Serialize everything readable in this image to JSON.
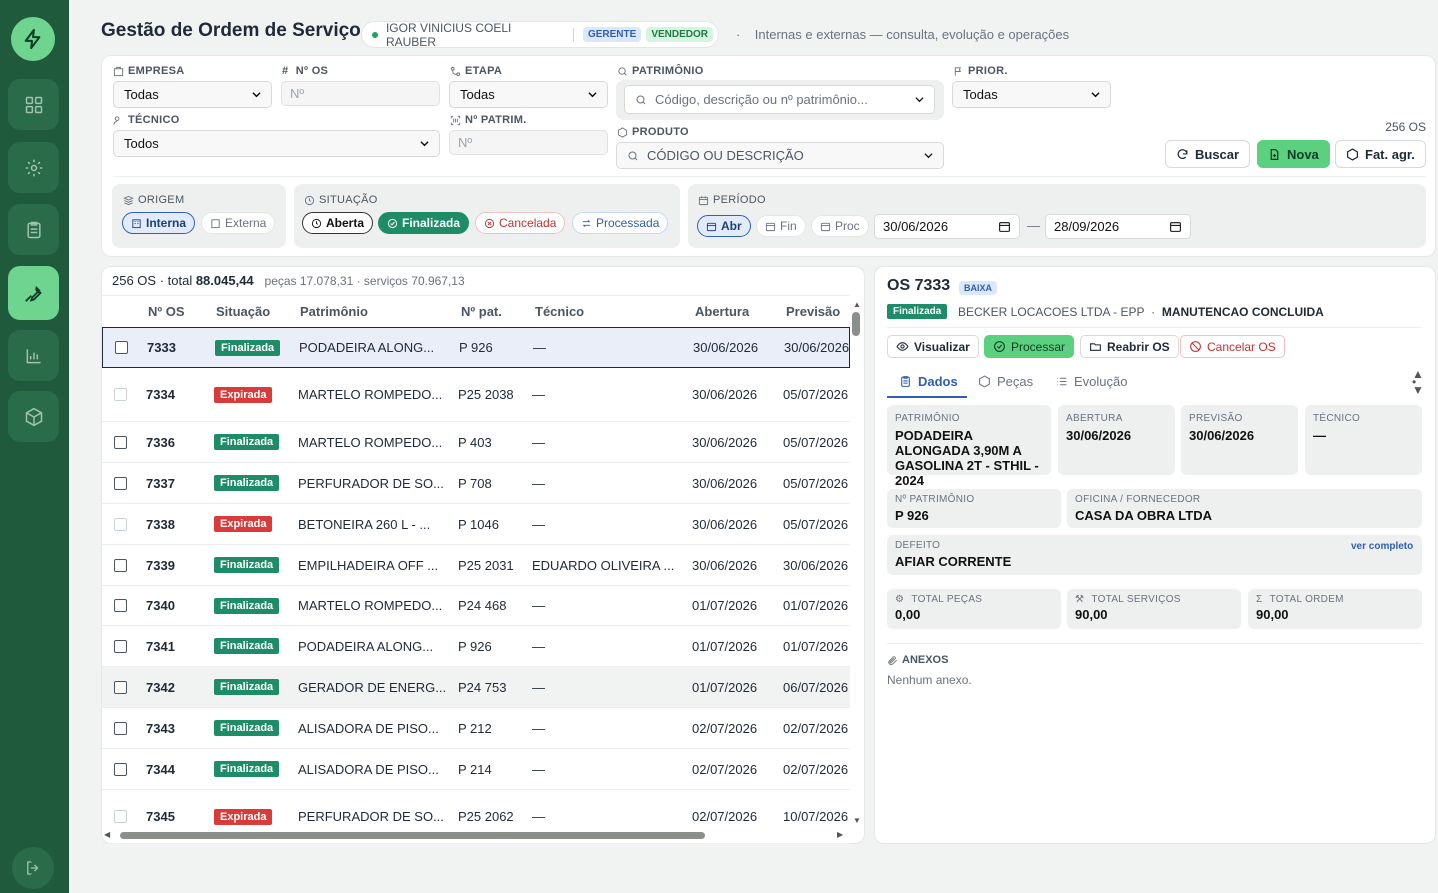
{
  "page": {
    "title": "Gestão de Ordem de Serviço",
    "user": "IGOR VINICIUS COELI RAUBER",
    "role1": "GERENTE",
    "role2": "VENDEDOR",
    "subtitle": "Internas e externas — consulta, evolução e operações"
  },
  "filters": {
    "empresa_label": "EMPRESA",
    "empresa_value": "Todas",
    "nos_label": "Nº OS",
    "nos_placeholder": "Nº",
    "etapa_label": "ETAPA",
    "etapa_value": "Todas",
    "patrimonio_label": "PATRIMÔNIO",
    "patrimonio_placeholder": "Código, descrição ou nº patrimônio...",
    "prior_label": "PRIOR.",
    "prior_value": "Todas",
    "tecnico_label": "TÉCNICO",
    "tecnico_value": "Todos",
    "npatrim_label": "Nº PATRIM.",
    "npatrim_placeholder": "Nº",
    "produto_label": "PRODUTO",
    "produto_placeholder": "CÓDIGO OU DESCRIÇÃO",
    "count": "256 OS",
    "buscar": "Buscar",
    "nova": "Nova",
    "fatagr": "Fat. agr."
  },
  "origem": {
    "label": "ORIGEM",
    "interna": "Interna",
    "externa": "Externa"
  },
  "situacao": {
    "label": "SITUAÇÃO",
    "aberta": "Aberta",
    "finalizada": "Finalizada",
    "cancelada": "Cancelada",
    "processada": "Processada"
  },
  "periodo": {
    "label": "PERÍODO",
    "abr": "Abr",
    "fin": "Fin",
    "proc": "Proc",
    "from": "30/06/2026",
    "to": "28/09/2026",
    "dash": "—"
  },
  "summary": {
    "count": "256 OS · total ",
    "total": "88.045,44",
    "extra": "peças 17.078,31 · serviços 70.967,13"
  },
  "columns": [
    "Nº OS",
    "Situação",
    "Patrimônio",
    "Nº pat.",
    "Técnico",
    "Abertura",
    "Previsão"
  ],
  "rows": [
    {
      "os": "7333",
      "st": "Finalizada",
      "pat": "PODADEIRA ALONG...",
      "np": "P 926",
      "tec": "—",
      "ab": "30/06/2026",
      "pv": "30/06/2026"
    },
    {
      "os": "7334",
      "st": "Expirada",
      "pat": "MARTELO ROMPEDO...",
      "np": "P25 2038",
      "tec": "—",
      "ab": "30/06/2026",
      "pv": "05/07/2026"
    },
    {
      "os": "7336",
      "st": "Finalizada",
      "pat": "MARTELO ROMPEDO...",
      "np": "P 403",
      "tec": "—",
      "ab": "30/06/2026",
      "pv": "05/07/2026"
    },
    {
      "os": "7337",
      "st": "Finalizada",
      "pat": "PERFURADOR DE SO...",
      "np": "P 708",
      "tec": "—",
      "ab": "30/06/2026",
      "pv": "05/07/2026"
    },
    {
      "os": "7338",
      "st": "Expirada",
      "pat": "BETONEIRA 260 L - ...",
      "np": "P 1046",
      "tec": "—",
      "ab": "30/06/2026",
      "pv": "05/07/2026"
    },
    {
      "os": "7339",
      "st": "Finalizada",
      "pat": "EMPILHADEIRA OFF ...",
      "np": "P25 2031",
      "tec": "EDUARDO OLIVEIRA ...",
      "ab": "30/06/2026",
      "pv": "30/06/2026"
    },
    {
      "os": "7340",
      "st": "Finalizada",
      "pat": "MARTELO ROMPEDO...",
      "np": "P24 468",
      "tec": "—",
      "ab": "01/07/2026",
      "pv": "01/07/2026"
    },
    {
      "os": "7341",
      "st": "Finalizada",
      "pat": "PODADEIRA ALONG...",
      "np": "P 926",
      "tec": "—",
      "ab": "01/07/2026",
      "pv": "01/07/2026"
    },
    {
      "os": "7342",
      "st": "Finalizada",
      "pat": "GERADOR DE ENERG...",
      "np": "P24 753",
      "tec": "—",
      "ab": "01/07/2026",
      "pv": "06/07/2026"
    },
    {
      "os": "7343",
      "st": "Finalizada",
      "pat": "ALISADORA DE PISO...",
      "np": "P 212",
      "tec": "—",
      "ab": "02/07/2026",
      "pv": "02/07/2026"
    },
    {
      "os": "7344",
      "st": "Finalizada",
      "pat": "ALISADORA DE PISO...",
      "np": "P 214",
      "tec": "—",
      "ab": "02/07/2026",
      "pv": "02/07/2026"
    },
    {
      "os": "7345",
      "st": "Expirada",
      "pat": "PERFURADOR DE SO...",
      "np": "P25 2062",
      "tec": "—",
      "ab": "02/07/2026",
      "pv": "10/07/2026"
    }
  ],
  "detail": {
    "os": "OS 7333",
    "tag": "BAIXA",
    "status": "Finalizada",
    "cliente": "BECKER LOCACOES LTDA - EPP",
    "dot": "·",
    "etapa": "MANUTENCAO CONCLUIDA",
    "visualizar": "Visualizar",
    "processar": "Processar",
    "reabrir": "Reabrir OS",
    "cancelar": "Cancelar OS",
    "tab_dados": "Dados",
    "tab_pecas": "Peças",
    "tab_evolucao": "Evolução",
    "patrimonio_l": "PATRIMÔNIO",
    "patrimonio_v": "PODADEIRA ALONGADA 3,90M A GASOLINA 2T - STHIL - 2024",
    "abertura_l": "ABERTURA",
    "abertura_v": "30/06/2026",
    "previsao_l": "PREVISÃO",
    "previsao_v": "30/06/2026",
    "tecnico_l": "TÉCNICO",
    "tecnico_v": "—",
    "npat_l": "Nº PATRIMÔNIO",
    "npat_v": "P 926",
    "oficina_l": "OFICINA / FORNECEDOR",
    "oficina_v": "CASA DA OBRA LTDA",
    "defeito_l": "DEFEITO",
    "defeito_v": "AFIAR CORRENTE",
    "ver": "ver completo",
    "tpecas_l": "TOTAL PEÇAS",
    "tpecas_v": "0,00",
    "tserv_l": "TOTAL SERVIÇOS",
    "tserv_v": "90,00",
    "tordem_l": "TOTAL ORDEM",
    "tordem_v": "90,00",
    "anexos_l": "ANEXOS",
    "anexos_v": "Nenhum anexo."
  },
  "colors": {
    "sidebar": "#1f5a3c",
    "accent": "#5bd07f",
    "finalizada": "#1e8c66",
    "expirada": "#d93a3a"
  }
}
